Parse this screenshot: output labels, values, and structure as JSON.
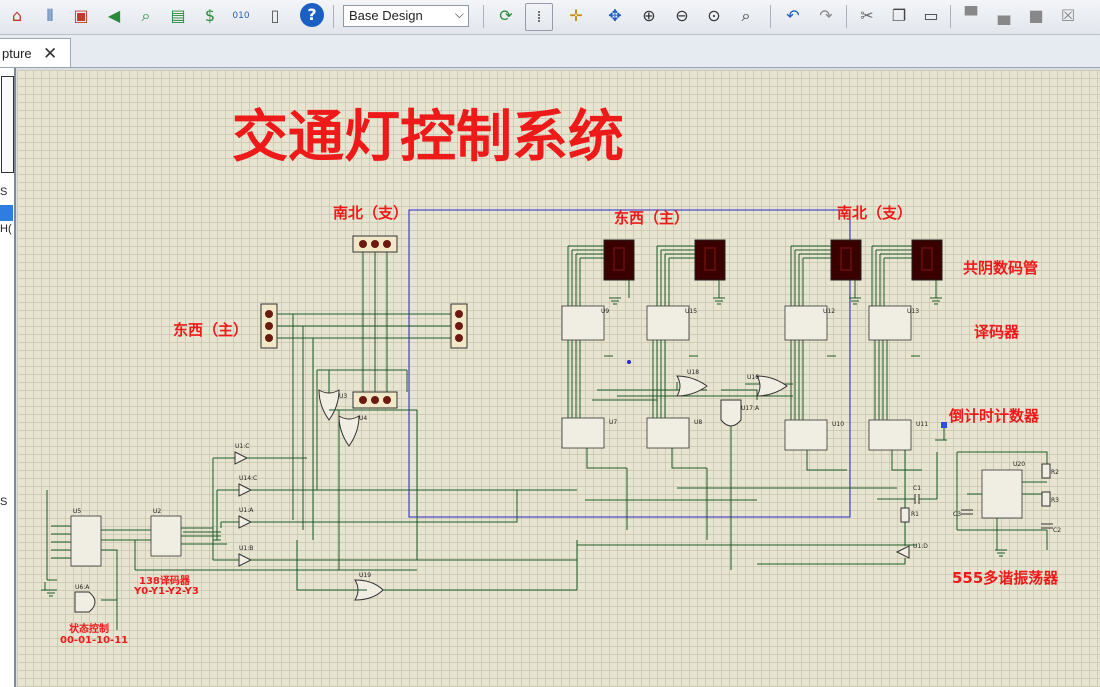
{
  "toolbar": {
    "design_select": "Base Design",
    "icons": [
      "home-icon",
      "component-mode-icon",
      "chip-icon",
      "sound-icon",
      "search-icon",
      "pcb-icon",
      "dollar-icon",
      "binary-icon",
      "document-icon",
      "help-icon",
      "refresh-icon",
      "grid-icon",
      "origin-icon",
      "pan-icon",
      "zoom-in-icon",
      "zoom-out-icon",
      "zoom-all-icon",
      "zoom-area-icon",
      "undo-icon",
      "redo-icon",
      "cut-icon",
      "copy-icon",
      "paste-icon",
      "block-copy-icon",
      "block-move-icon",
      "block-rotate-icon",
      "block-delete-icon"
    ],
    "dropdown_glyph": "⌵"
  },
  "tab": {
    "label": "pture",
    "close": "✕"
  },
  "left_strip": {
    "s1": "S",
    "s2": "H(",
    "s3": "S"
  },
  "schematic": {
    "title": "交通灯控制系统",
    "labels": {
      "ns_branch_left": "南北（支）",
      "ew_main_top": "东西（主）",
      "ns_branch_right": "南北（支）",
      "ew_main_left": "东西（主）",
      "seven_seg": "共阴数码管",
      "decoder": "译码器",
      "countdown": "倒计时计数器",
      "osc555": "555多谐振荡器",
      "decoder138": "138译码器",
      "y_outputs": "Y0-Y1-Y2-Y3",
      "state_ctrl": "状态控制",
      "state_codes": "00-01-10-11"
    },
    "refs": {
      "u9": "U9",
      "u15": "U15",
      "u12": "U12",
      "u13": "U13",
      "u7": "U7",
      "u8": "U8",
      "u10": "U10",
      "u11": "U11",
      "u18": "U18",
      "u16": "U16",
      "u17a": "U17:A",
      "u3": "U3",
      "u4": "U4",
      "u5": "U5",
      "u2": "U2",
      "u6a": "U6:A",
      "u1c": "U1:C",
      "u14c": "U14:C",
      "u1a": "U1:A",
      "u1b": "U1:B",
      "u19": "U19",
      "u20": "U20",
      "u1d": "U1:D",
      "r1": "R1",
      "r2": "R2",
      "r3": "R3",
      "c1": "C1",
      "c2": "C2",
      "c3": "C3"
    }
  }
}
